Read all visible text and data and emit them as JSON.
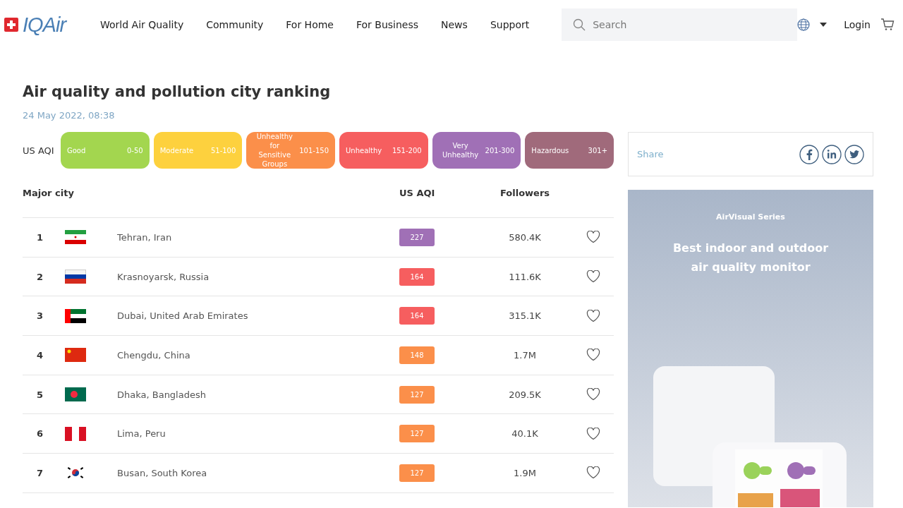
{
  "header": {
    "logo": "IQAir",
    "nav": [
      "World Air Quality",
      "Community",
      "For Home",
      "For Business",
      "News",
      "Support"
    ],
    "search": {
      "placeholder": "Search"
    },
    "login": "Login"
  },
  "title": "Air quality and pollution city ranking",
  "date": "24 May 2022, 08:38",
  "legend": {
    "label": "US AQI",
    "items": [
      {
        "label": "Good",
        "range": "0-50",
        "color": "#a3d64f"
      },
      {
        "label": "Moderate",
        "range": "51-100",
        "color": "#fdd13e"
      },
      {
        "label": "Unhealthy for Sensitive Groups",
        "range": "101-150",
        "color": "#fb8f4a"
      },
      {
        "label": "Unhealthy",
        "range": "151-200",
        "color": "#f65e5f"
      },
      {
        "label": "Very Unhealthy",
        "range": "201-300",
        "color": "#a070b6"
      },
      {
        "label": "Hazardous",
        "range": "301+",
        "color": "#a06a7b"
      }
    ]
  },
  "table": {
    "columns": [
      "Major city",
      "US AQI",
      "Followers"
    ],
    "rows": [
      {
        "rank": "1",
        "flag": {
          "kind": "iran"
        },
        "city": "Tehran, Iran",
        "aqi": "227",
        "color": "#a070b6",
        "followers": "580.4K"
      },
      {
        "rank": "2",
        "flag": {
          "kind": "russia"
        },
        "city": "Krasnoyarsk, Russia",
        "aqi": "164",
        "color": "#f65e5f",
        "followers": "111.6K"
      },
      {
        "rank": "3",
        "flag": {
          "kind": "uae"
        },
        "city": "Dubai, United Arab Emirates",
        "aqi": "164",
        "color": "#f65e5f",
        "followers": "315.1K"
      },
      {
        "rank": "4",
        "flag": {
          "kind": "china"
        },
        "city": "Chengdu, China",
        "aqi": "148",
        "color": "#fb8f4a",
        "followers": "1.7M"
      },
      {
        "rank": "5",
        "flag": {
          "kind": "bangladesh"
        },
        "city": "Dhaka, Bangladesh",
        "aqi": "127",
        "color": "#fb8f4a",
        "followers": "209.5K"
      },
      {
        "rank": "6",
        "flag": {
          "kind": "peru"
        },
        "city": "Lima, Peru",
        "aqi": "127",
        "color": "#fb8f4a",
        "followers": "40.1K"
      },
      {
        "rank": "7",
        "flag": {
          "kind": "korea"
        },
        "city": "Busan, South Korea",
        "aqi": "127",
        "color": "#fb8f4a",
        "followers": "1.9M"
      }
    ]
  },
  "share": {
    "label": "Share"
  },
  "ad": {
    "kicker": "AirVisual Series",
    "headline": "Best indoor and outdoor air quality monitor"
  }
}
